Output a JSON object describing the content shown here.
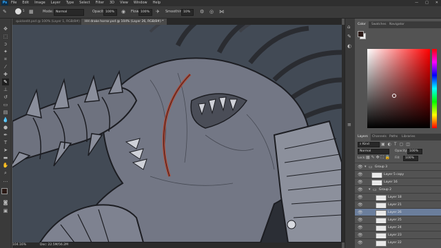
{
  "menu": {
    "app_icon": "Ps",
    "items": [
      "File",
      "Edit",
      "Image",
      "Layer",
      "Type",
      "Select",
      "Filter",
      "3D",
      "View",
      "Window",
      "Help"
    ],
    "window_controls": [
      "—",
      "□",
      "✕"
    ]
  },
  "options": {
    "mode_label": "Mode:",
    "mode_value": "Normal",
    "opacity_label": "Opacity:",
    "opacity_value": "100%",
    "flow_label": "Flow:",
    "flow_value": "100%",
    "smoothing_label": "Smoothing:",
    "smoothing_value": "10%",
    "brush_size": "5"
  },
  "tabs": [
    {
      "label": "quickedit.psd @ 100% (Layer 1, RGB/8#) ×"
    },
    {
      "label": "HH drake horror.psd @ 104% (Layer 26, RGB/8#) *"
    }
  ],
  "status": {
    "zoom": "104.16%",
    "doc": "Doc: 22.5M/56.2M"
  },
  "tools": [
    "move",
    "marquee",
    "lasso",
    "quick-select",
    "crop",
    "eyedropper",
    "healing",
    "brush",
    "stamp",
    "history-brush",
    "eraser",
    "gradient",
    "blur",
    "dodge",
    "pen",
    "type",
    "path-select",
    "shape",
    "hand",
    "zoom",
    "more",
    "colors"
  ],
  "color_panel": {
    "tabs": [
      "Color",
      "Swatches",
      "Navigator"
    ],
    "fg_color": "#2b1a16",
    "bg_color": "#f0f0f0"
  },
  "layers_panel": {
    "tabs": [
      "Layers",
      "Channels",
      "Paths",
      "Libraries"
    ],
    "kind_label": "Kind",
    "blend_mode": "Normal",
    "opacity_label": "Opacity:",
    "opacity_value": "100%",
    "lock_label": "Lock:",
    "fill_label": "Fill:",
    "fill_value": "100%",
    "layers": [
      {
        "name": "Group 3",
        "kind": "group",
        "indent": 0
      },
      {
        "name": "Layer 5 copy",
        "kind": "layer",
        "indent": 1
      },
      {
        "name": "Layer 16",
        "kind": "layer",
        "indent": 1
      },
      {
        "name": "Group 2",
        "kind": "group",
        "indent": 1
      },
      {
        "name": "Layer 18",
        "kind": "layer",
        "indent": 2
      },
      {
        "name": "Layer 21",
        "kind": "layer",
        "indent": 2
      },
      {
        "name": "Layer 26",
        "kind": "layer",
        "indent": 2,
        "selected": true
      },
      {
        "name": "Layer 25",
        "kind": "layer",
        "indent": 2
      },
      {
        "name": "Layer 24",
        "kind": "layer",
        "indent": 2
      },
      {
        "name": "Layer 23",
        "kind": "layer",
        "indent": 2
      },
      {
        "name": "Layer 22",
        "kind": "layer",
        "indent": 2
      }
    ]
  }
}
